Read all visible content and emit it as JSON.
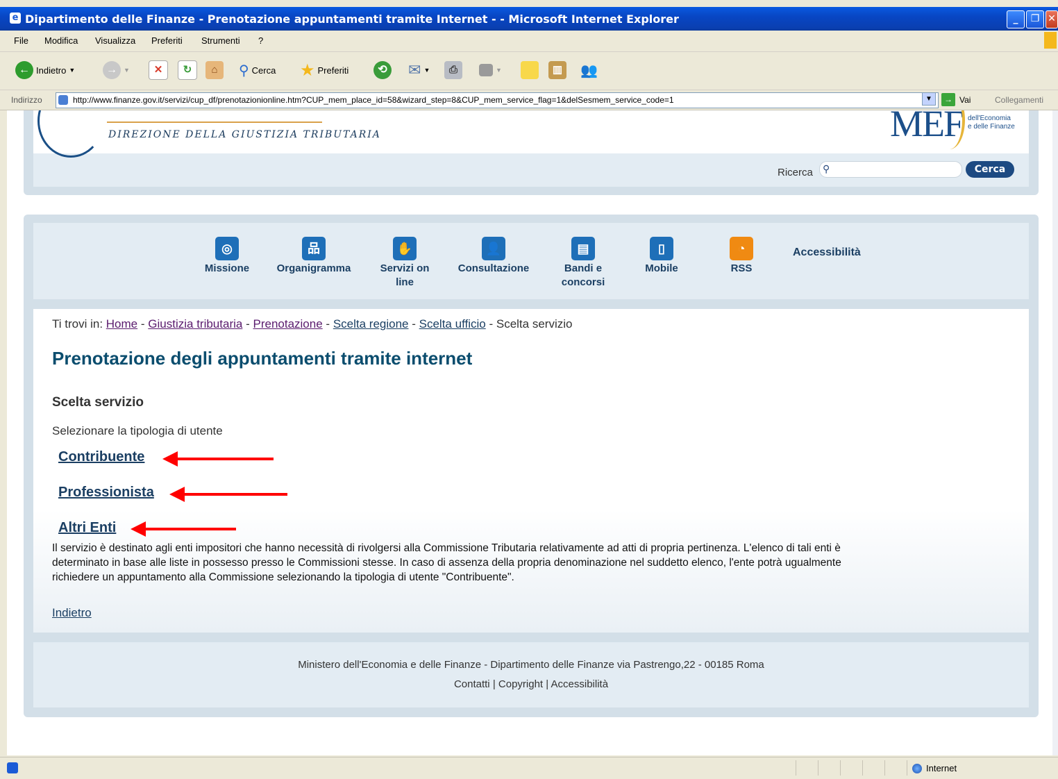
{
  "window": {
    "title": "Dipartimento delle Finanze - Prenotazione appuntamenti tramite Internet - - Microsoft Internet Explorer",
    "minimize": "_",
    "maximize": "❐",
    "close": "✕"
  },
  "menu": [
    "File",
    "Modifica",
    "Visualizza",
    "Preferiti",
    "Strumenti",
    "?"
  ],
  "toolbar": {
    "back_label": "Indietro",
    "search_label": "Cerca",
    "favorites_label": "Preferiti",
    "colors": {
      "back": "#2e9c2e",
      "stop": "#d83a2a",
      "refresh": "#3a9c3a",
      "star": "#f4b81c"
    }
  },
  "address": {
    "label": "Indirizzo",
    "url": "http://www.finanze.gov.it/servizi/cup_df/prenotazionionline.htm?CUP_mem_place_id=58&wizard_step=8&CUP_mem_service_flag=1&delSesmem_service_code=1",
    "go_label": "Vai",
    "links_label": "Collegamenti"
  },
  "header": {
    "direzione": "DIREZIONE DELLA GIUSTIZIA TRIBUTARIA",
    "mef_logo": "MEF",
    "ministero_line1": "dell'Economia",
    "ministero_line2": "e delle Finanze",
    "search_label": "Ricerca",
    "search_value": "",
    "search_button": "Cerca"
  },
  "nav": {
    "items": [
      {
        "label": "Missione",
        "icon": "target-icon",
        "color": "#1e6fb8"
      },
      {
        "label": "Organigramma",
        "icon": "org-chart-icon",
        "color": "#1e6fb8"
      },
      {
        "label": "Servizi on line",
        "icon": "hand-icon",
        "color": "#1e6fb8"
      },
      {
        "label": "Consultazione",
        "icon": "people-icon",
        "color": "#1e6fb8"
      },
      {
        "label": "Bandi e concorsi",
        "icon": "document-icon",
        "color": "#1e6fb8"
      },
      {
        "label": "Mobile",
        "icon": "mobile-icon",
        "color": "#1e6fb8"
      },
      {
        "label": "RSS",
        "icon": "rss-icon",
        "color": "#f08a12"
      }
    ],
    "accessibility": "Accessibilità"
  },
  "breadcrumb": {
    "prefix": "Ti trovi in:",
    "items": [
      "Home",
      "Giustizia tributaria",
      "Prenotazione",
      "Scelta regione",
      "Scelta ufficio",
      "Scelta servizio"
    ],
    "separator": "-"
  },
  "main": {
    "title": "Prenotazione degli appuntamenti tramite internet",
    "subtitle": "Scelta servizio",
    "instruction": "Selezionare la tipologia di utente",
    "choices": [
      "Contribuente",
      "Professionista",
      "Altri Enti"
    ],
    "description": "Il servizio è destinato agli enti impositori che hanno necessità di rivolgersi alla Commissione Tributaria relativamente ad atti di propria pertinenza. L'elenco di tali enti è determinato in base alle liste in possesso presso le Commissioni stesse. In caso di assenza della propria denominazione nel suddetto elenco, l'ente potrà ugualmente richiedere un appuntamento alla Commissione selezionando la tipologia di utente \"Contribuente\".",
    "back_link": "Indietro",
    "annotation_color": "#ff0000"
  },
  "footer": {
    "address": "Ministero dell'Economia e delle Finanze - Dipartimento delle Finanze via Pastrengo,22 - 00185 Roma",
    "contatti": "Contatti",
    "copyright": "Copyright",
    "accessibilita": "Accessibilità",
    "sep": "|"
  },
  "status": {
    "zone": "Internet"
  }
}
